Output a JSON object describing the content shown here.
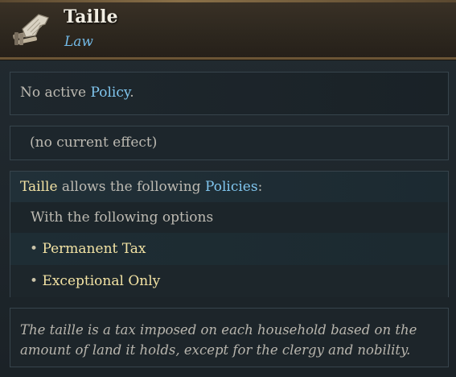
{
  "header": {
    "title": "Taille",
    "subtitle": "Law",
    "icon": "law-scroll-icon"
  },
  "policy_panel": {
    "prefix": "No active ",
    "policy_word": "Policy",
    "suffix": "."
  },
  "effect_panel": {
    "text": "(no current effect)"
  },
  "policies_panel": {
    "law_name": "Taille",
    "middle": " allows the following ",
    "policies_word": "Policies",
    "colon": ":",
    "options_label": "With the following options",
    "bullet": "•",
    "options": [
      "Permanent Tax",
      "Exceptional Only"
    ]
  },
  "description": {
    "line1": "The taille is a tax imposed on each household based on the",
    "line2": "amount of land it holds, except for the clergy and nobility."
  },
  "colors": {
    "header_bg": "#2e281f",
    "title": "#f1ede2",
    "link": "#80c6ef",
    "highlight": "#f3e3a4",
    "panel_bg": "#1d262c"
  }
}
